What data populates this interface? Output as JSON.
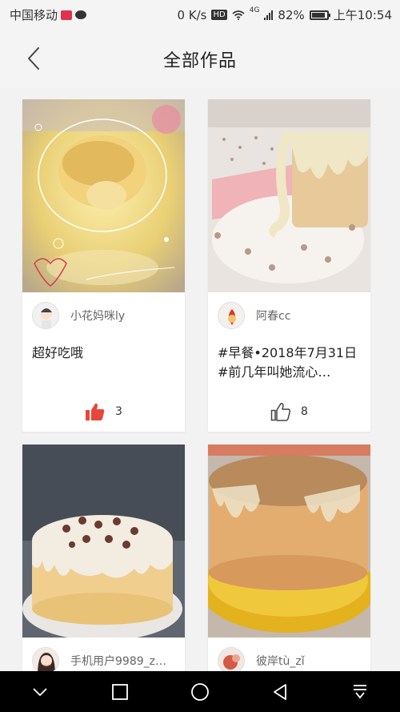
{
  "status_bar": {
    "carrier": "中国移动",
    "speed": "0 K/s",
    "hd": "HD",
    "network": "4G",
    "battery": "82%",
    "time": "上午10:54"
  },
  "header": {
    "title": "全部作品"
  },
  "works": [
    {
      "author": "小花妈咪ly",
      "description": "超好吃哦",
      "likes": "3",
      "liked": true
    },
    {
      "author": "阿春cc",
      "description": "#早餐•2018年7月31日#前几年叫她流心…",
      "likes": "8",
      "liked": false
    },
    {
      "author": "手机用户9989_z…",
      "description": "",
      "likes": "",
      "liked": false
    },
    {
      "author": "彼岸tù_zǐ",
      "description": "",
      "likes": "",
      "liked": false
    }
  ],
  "colors": {
    "like_active": "#e8453c",
    "background": "#f2f2f2",
    "navbar": "#000000"
  }
}
